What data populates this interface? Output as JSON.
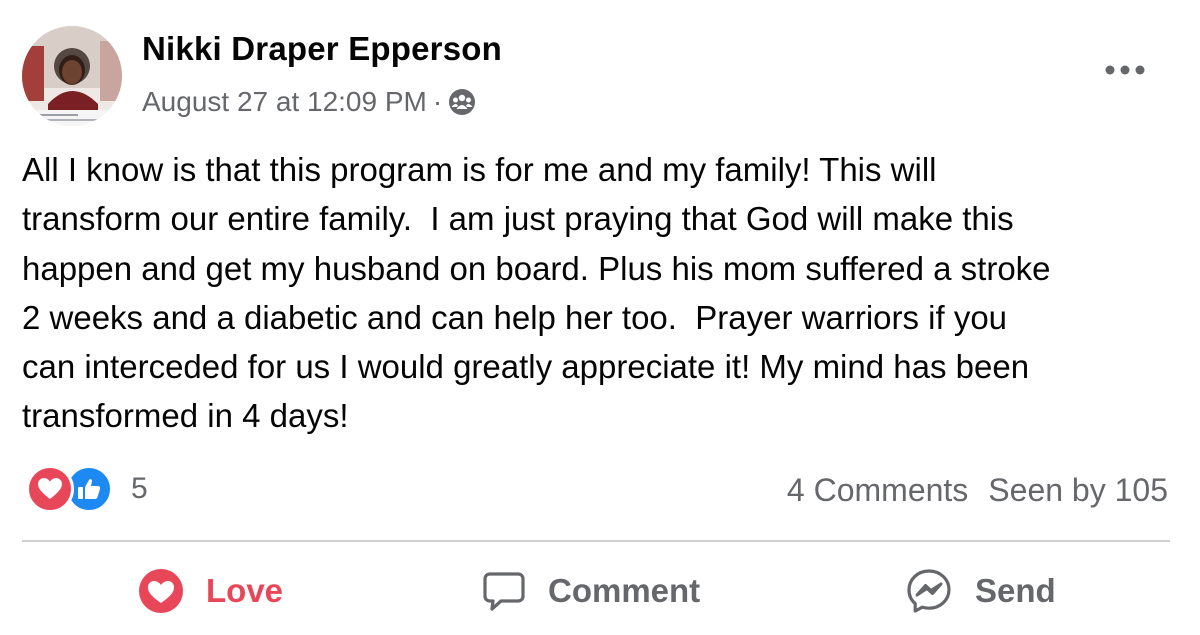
{
  "post": {
    "author": "Nikki Draper Epperson",
    "timestamp": "August 27 at 12:09 PM",
    "separator": "·",
    "audience_icon": "group-audience-icon",
    "more_icon": "more-options-icon",
    "text": "All I know is that this program is for me and my family! This will\ntransform our entire family.  I am just praying that God will make this\nhappen and get my husband on board. Plus his mom suffered a stroke\n2 weeks and a diabetic and can help her too.  Prayer warriors if you\ncan interceded for us I would greatly appreciate it! My mind has been\ntransformed in 4 days!"
  },
  "reactions": {
    "types": [
      "love-reaction-icon",
      "like-reaction-icon"
    ],
    "count": "5"
  },
  "stats": {
    "comments": "4 Comments",
    "seen": "Seen by 105"
  },
  "actions": {
    "love_label": "Love",
    "comment_label": "Comment",
    "send_label": "Send"
  },
  "colors": {
    "love": "#e8475a",
    "like": "#1d8af3",
    "secondary_text": "#65676b",
    "divider": "#ced0d4"
  }
}
